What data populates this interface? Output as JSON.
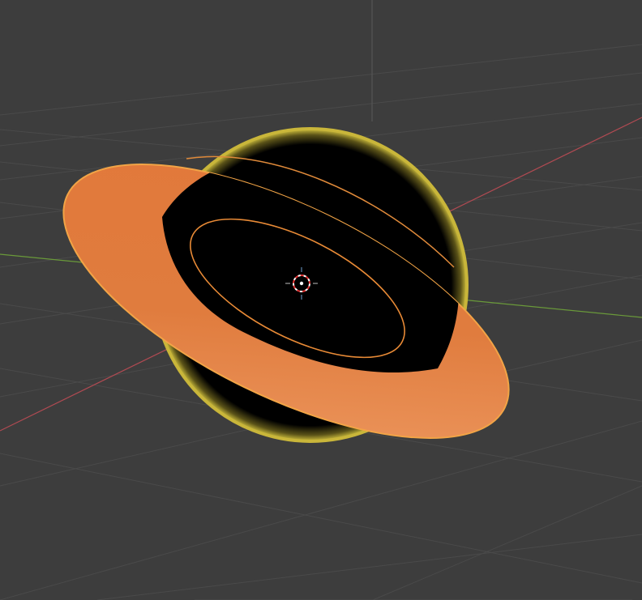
{
  "viewport": {
    "view": "perspective",
    "background_color": "#3d3d3d",
    "grid_color": "#4a4a4a",
    "x_axis_color": "#b04a52",
    "y_axis_color": "#6a9a3a",
    "z_axis_color": "#5a5a5a"
  },
  "scene": {
    "objects": [
      {
        "name": "sphere",
        "shading": "solid",
        "color": "#000000",
        "selected": true,
        "outline_color": "#c8b43a"
      },
      {
        "name": "disc",
        "shading": "solid",
        "color": "#e07a3e",
        "active": true,
        "outline_color": "#f0a040"
      }
    ]
  },
  "cursor_3d": {
    "ring_colors": [
      "#ffffff",
      "#e03030"
    ]
  }
}
